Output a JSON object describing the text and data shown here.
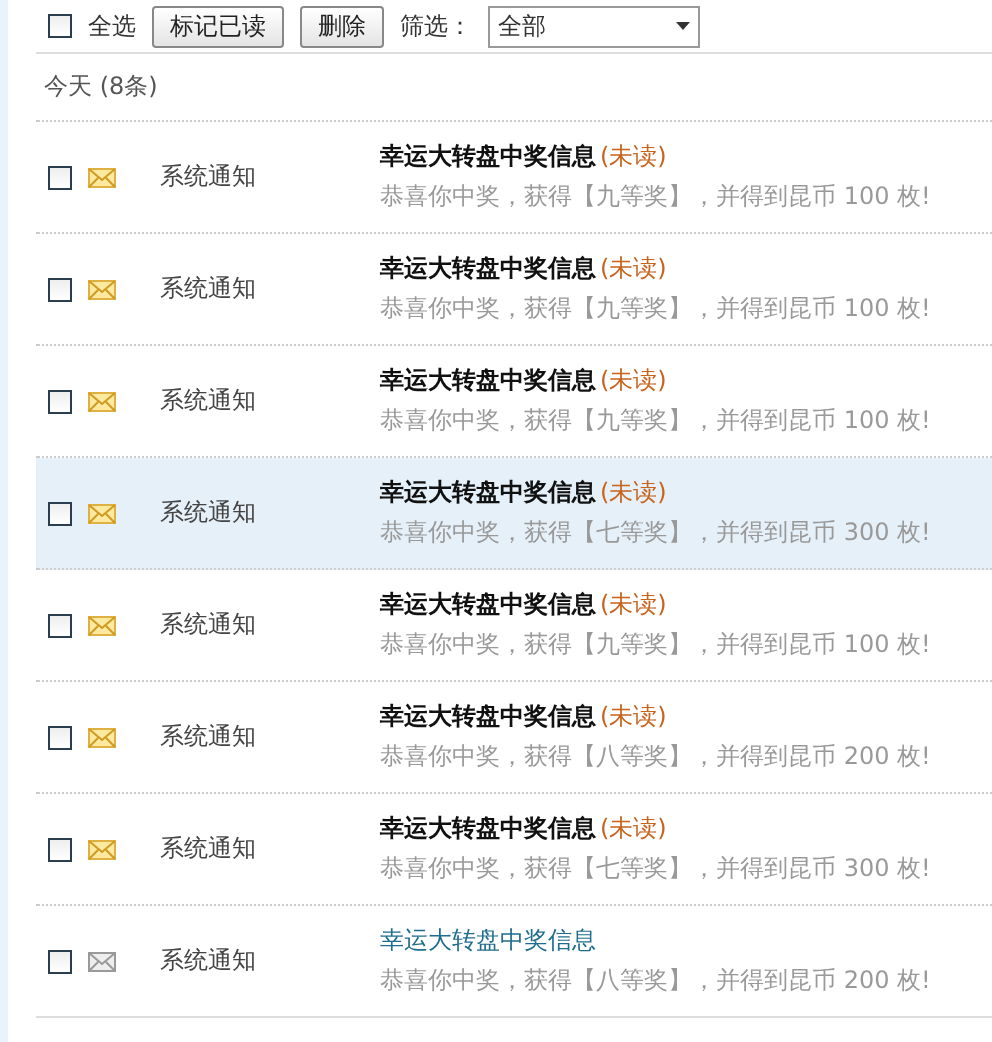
{
  "toolbar": {
    "select_all": {
      "label": "全选",
      "checked": false
    },
    "buttons": [
      "标记已读",
      "删除"
    ],
    "filter": {
      "label": "筛选：",
      "value": "全部"
    }
  },
  "group": {
    "title": "今天 (8条)"
  },
  "messages": [
    {
      "checked": false,
      "unread": true,
      "highlighted": false,
      "sender": "系统通知",
      "title": "幸运大转盘中奖信息",
      "status": "(未读)",
      "body": "恭喜你中奖，获得【九等奖】，并得到昆币 100 枚!"
    },
    {
      "checked": false,
      "unread": true,
      "highlighted": false,
      "sender": "系统通知",
      "title": "幸运大转盘中奖信息",
      "status": "(未读)",
      "body": "恭喜你中奖，获得【九等奖】，并得到昆币 100 枚!"
    },
    {
      "checked": false,
      "unread": true,
      "highlighted": false,
      "sender": "系统通知",
      "title": "幸运大转盘中奖信息",
      "status": "(未读)",
      "body": "恭喜你中奖，获得【九等奖】，并得到昆币 100 枚!"
    },
    {
      "checked": false,
      "unread": true,
      "highlighted": true,
      "sender": "系统通知",
      "title": "幸运大转盘中奖信息",
      "status": "(未读)",
      "body": "恭喜你中奖，获得【七等奖】，并得到昆币 300 枚!"
    },
    {
      "checked": false,
      "unread": true,
      "highlighted": false,
      "sender": "系统通知",
      "title": "幸运大转盘中奖信息",
      "status": "(未读)",
      "body": "恭喜你中奖，获得【九等奖】，并得到昆币 100 枚!"
    },
    {
      "checked": false,
      "unread": true,
      "highlighted": false,
      "sender": "系统通知",
      "title": "幸运大转盘中奖信息",
      "status": "(未读)",
      "body": "恭喜你中奖，获得【八等奖】，并得到昆币 200 枚!"
    },
    {
      "checked": false,
      "unread": true,
      "highlighted": false,
      "sender": "系统通知",
      "title": "幸运大转盘中奖信息",
      "status": "(未读)",
      "body": "恭喜你中奖，获得【七等奖】，并得到昆币 300 枚!"
    },
    {
      "checked": false,
      "unread": false,
      "highlighted": false,
      "sender": "系统通知",
      "title": "幸运大转盘中奖信息",
      "body": "恭喜你中奖，获得【八等奖】，并得到昆币 200 枚!"
    }
  ]
}
